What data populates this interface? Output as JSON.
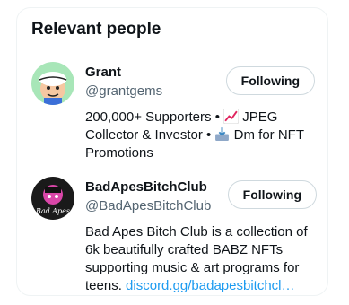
{
  "title": "Relevant people",
  "people": [
    {
      "name": "Grant",
      "handle": "@grantgems",
      "button_label": "Following",
      "bio_part1": "200,000+ Supporters •",
      "bio_emoji1": "chart-increasing-icon",
      "bio_part2": "JPEG Collector & Investor •",
      "bio_emoji2": "inbox-tray-icon",
      "bio_part3": "Dm for NFT Promotions"
    },
    {
      "name": "BadApesBitchClub",
      "handle": "@BadApesBitchClub",
      "button_label": "Following",
      "bio_text": "Bad Apes Bitch Club is a collection of 6k beautifully crafted BABZ NFTs supporting music & art programs for teens.",
      "bio_link": "discord.gg/badapesbitchcl…",
      "avatar_text": "Bad Apes"
    }
  ],
  "colors": {
    "link": "#1d9bf0",
    "secondary_text": "#536471",
    "border": "#eff3f4"
  }
}
